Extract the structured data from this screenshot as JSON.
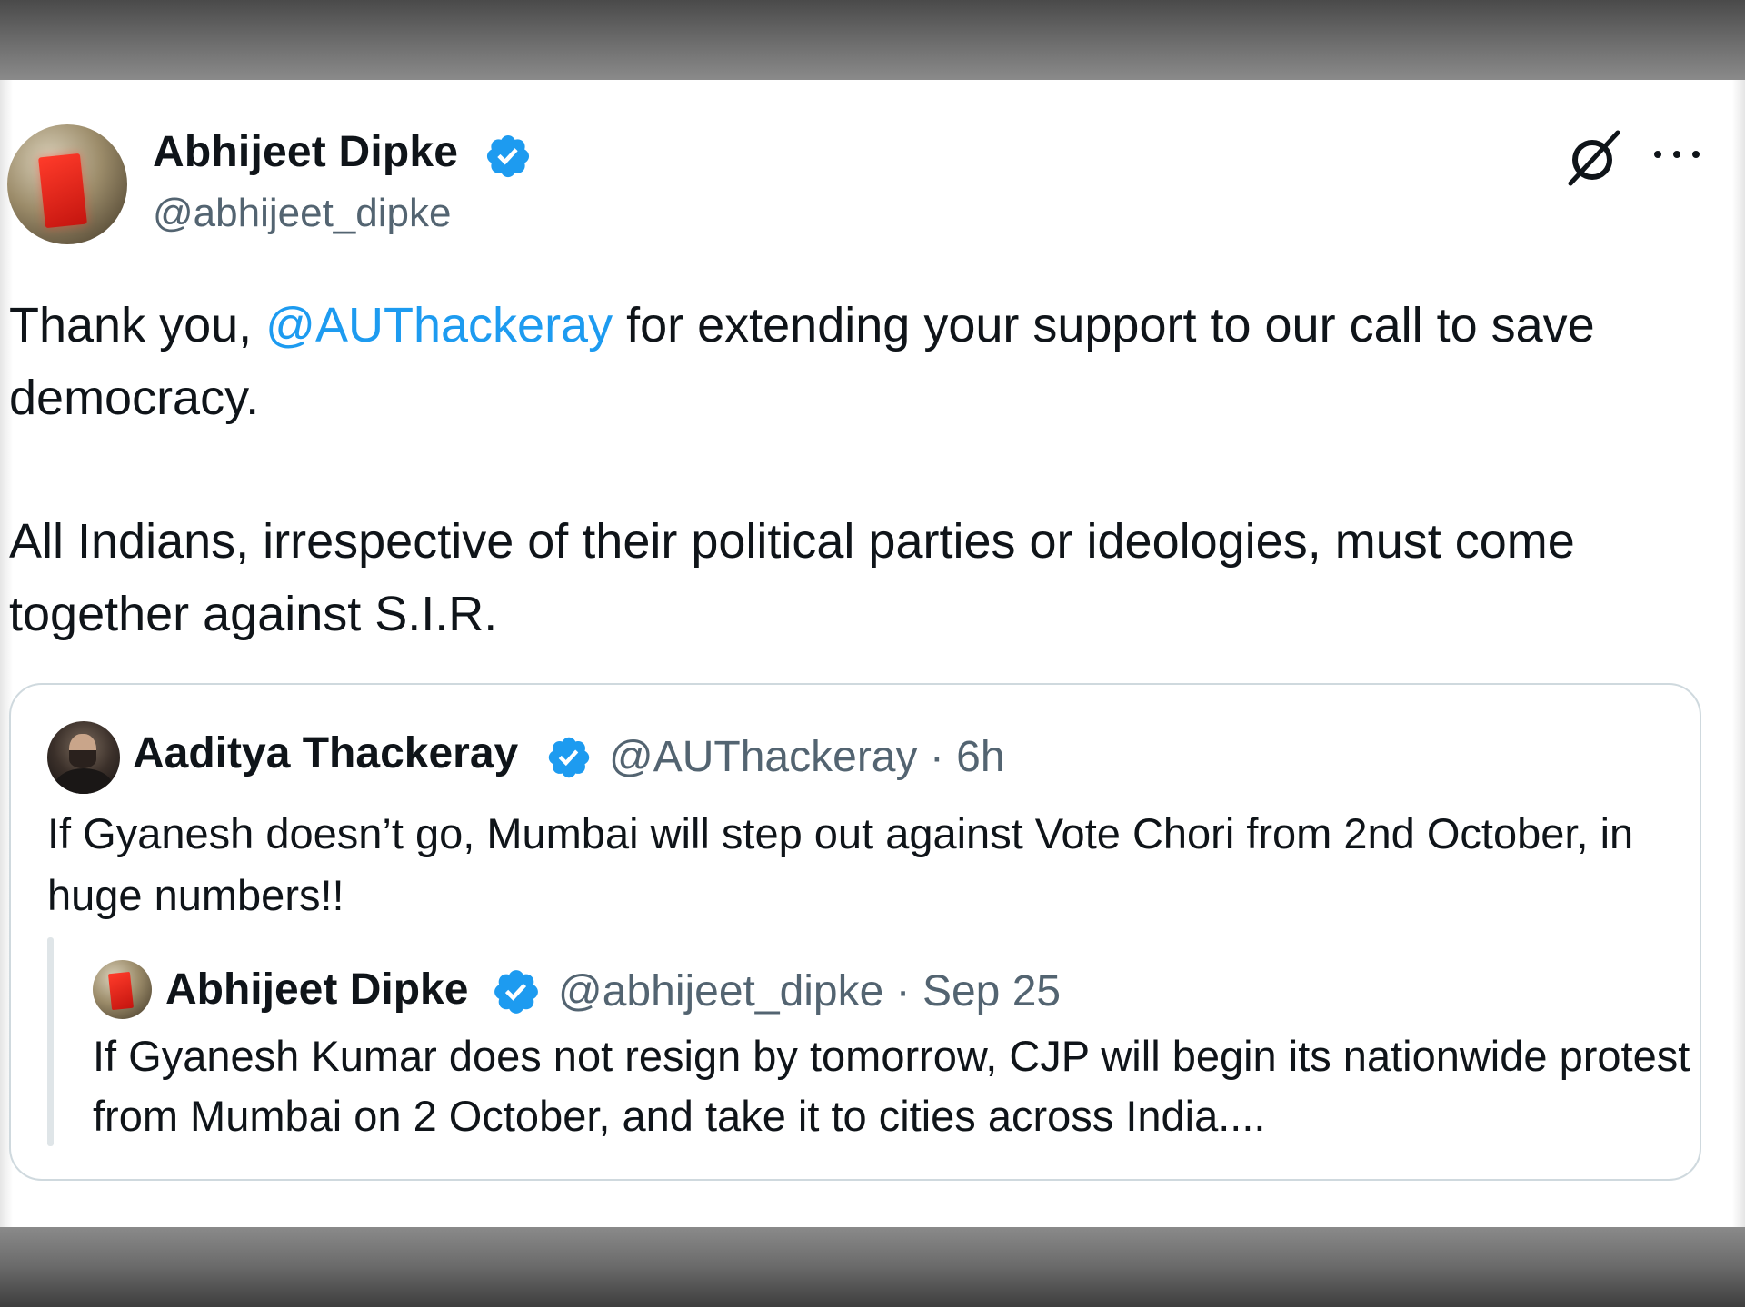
{
  "tweet": {
    "author_name": "Abhijeet Dipke",
    "author_handle": "@abhijeet_dipke",
    "text_parts": {
      "prefix": "Thank you, ",
      "mention": "@AUThackeray",
      "suffix": " for extending your support to our call to save democracy."
    },
    "paragraph2": "All Indians, irrespective of their political parties or ideologies, must come together against S.I.R."
  },
  "quote": {
    "author_name": "Aaditya Thackeray",
    "meta": "@AUThackeray · 6h",
    "text": "If Gyanesh doesn’t go, Mumbai will step out against Vote Chori from 2nd October, in huge numbers!!"
  },
  "nested_quote": {
    "author_name": "Abhijeet Dipke",
    "meta": "@abhijeet_dipke · Sep 25",
    "text": "If Gyanesh Kumar does not resign by tomorrow, CJP will begin its nationwide protest from Mumbai on 2 October, and take it to cities across India...."
  },
  "icons": {
    "verified": "verified-badge-icon",
    "grok": "grok-icon",
    "more": "more-options-icon"
  },
  "colors": {
    "accent": "#1d9bf0",
    "text": "#0f1419",
    "secondary": "#536471",
    "border": "#cfd9de"
  }
}
